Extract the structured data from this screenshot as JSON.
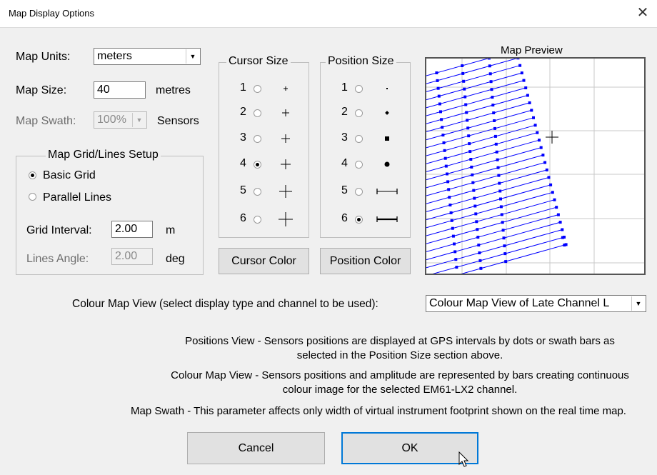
{
  "window": {
    "title": "Map Display Options",
    "close_glyph": "✕"
  },
  "units": {
    "label": "Map Units:",
    "value": "meters"
  },
  "size": {
    "label": "Map Size:",
    "value": "40",
    "unit": "metres"
  },
  "swath": {
    "label": "Map Swath:",
    "value": "100%",
    "unit": "Sensors"
  },
  "grid_setup": {
    "legend": "Map Grid/Lines Setup",
    "basic_grid": "Basic Grid",
    "parallel_lines": "Parallel Lines",
    "selected": "Basic Grid",
    "interval_label": "Grid Interval:",
    "interval_value": "2.00",
    "interval_unit": "m",
    "angle_label": "Lines Angle:",
    "angle_value": "2.00",
    "angle_unit": "deg"
  },
  "cursor_size": {
    "legend": "Cursor Size",
    "options": [
      "1",
      "2",
      "3",
      "4",
      "5",
      "6"
    ],
    "selected": "4"
  },
  "position_size": {
    "legend": "Position Size",
    "options": [
      "1",
      "2",
      "3",
      "4",
      "5",
      "6"
    ],
    "selected": "6"
  },
  "buttons": {
    "cursor_color": "Cursor Color",
    "position_color": "Position Color",
    "cancel": "Cancel",
    "ok": "OK"
  },
  "preview": {
    "title": "Map Preview",
    "line_color": "#0000ff"
  },
  "colour_map": {
    "label": "Colour Map View (select display type and channel to be used):",
    "value": "Colour Map View of Late Channel L"
  },
  "descriptions": {
    "positions": "Positions View - Sensors positions are displayed at GPS intervals by dots or swath bars as selected in the Position Size section above.",
    "colour_map": "Colour Map View - Sensors positions and amplitude are represented by bars creating continuous colour image for the selected EM61-LX2 channel.",
    "swath": "Map Swath - This parameter affects only width of virtual instrument footprint shown on the real time map."
  }
}
